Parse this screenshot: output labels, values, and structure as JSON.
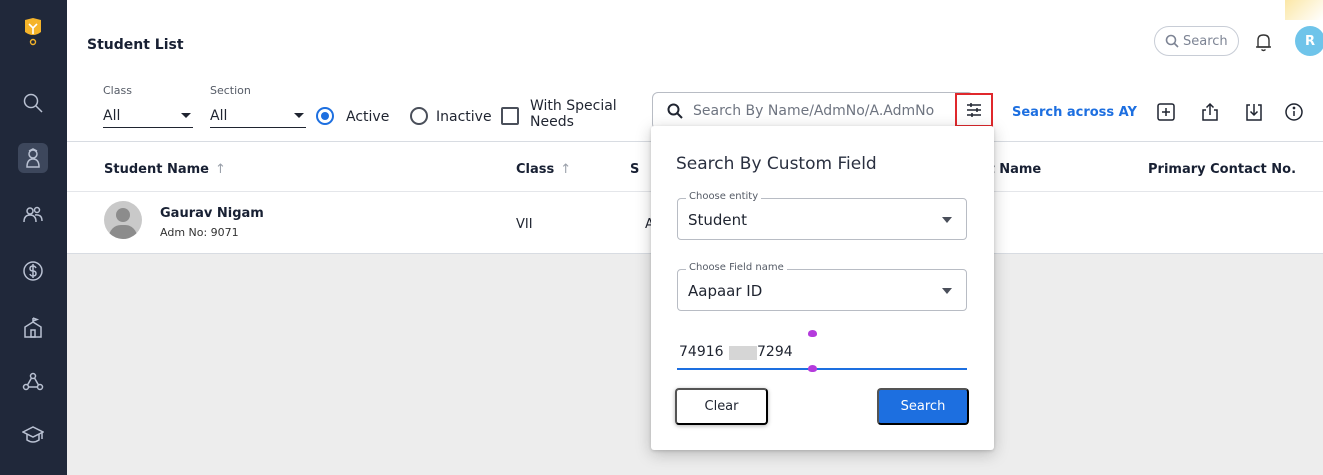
{
  "header": {
    "title": "Student List",
    "search_label": "Search",
    "avatar_initial": "R"
  },
  "filters": {
    "class_label": "Class",
    "class_value": "All",
    "section_label": "Section",
    "section_value": "All",
    "radio_active": "Active",
    "radio_inactive": "Inactive",
    "active_selected": true,
    "special_needs_line1": "With Special",
    "special_needs_line2": "Needs",
    "search_placeholder": "Search By Name/AdmNo/A.AdmNo",
    "search_across": "Search across AY"
  },
  "table": {
    "columns": [
      "Student Name",
      "Class",
      "S",
      "act Name",
      "Primary Contact No."
    ],
    "rows": [
      {
        "name": "Gaurav Nigam",
        "adm": "Adm No: 9071",
        "class": "VII",
        "section": "A"
      }
    ]
  },
  "popup": {
    "title": "Search By Custom Field",
    "entity_label": "Choose entity",
    "entity_value": "Student",
    "field_label": "Choose Field name",
    "field_value": "Aapaar ID",
    "value_prefix": "74916",
    "value_suffix": "7294",
    "clear_label": "Clear",
    "search_label": "Search"
  },
  "colors": {
    "accent": "#1d6fe0",
    "sidebar": "#20283a",
    "highlight_border": "#e0282c",
    "avatar": "#6fc4ea"
  },
  "icons": {
    "sidebar": [
      "logo-icon",
      "search-icon",
      "student-icon",
      "users-icon",
      "fees-icon",
      "school-icon",
      "network-icon",
      "academics-icon"
    ],
    "toolbar": [
      "add-icon",
      "export-icon",
      "import-icon",
      "info-icon"
    ]
  }
}
